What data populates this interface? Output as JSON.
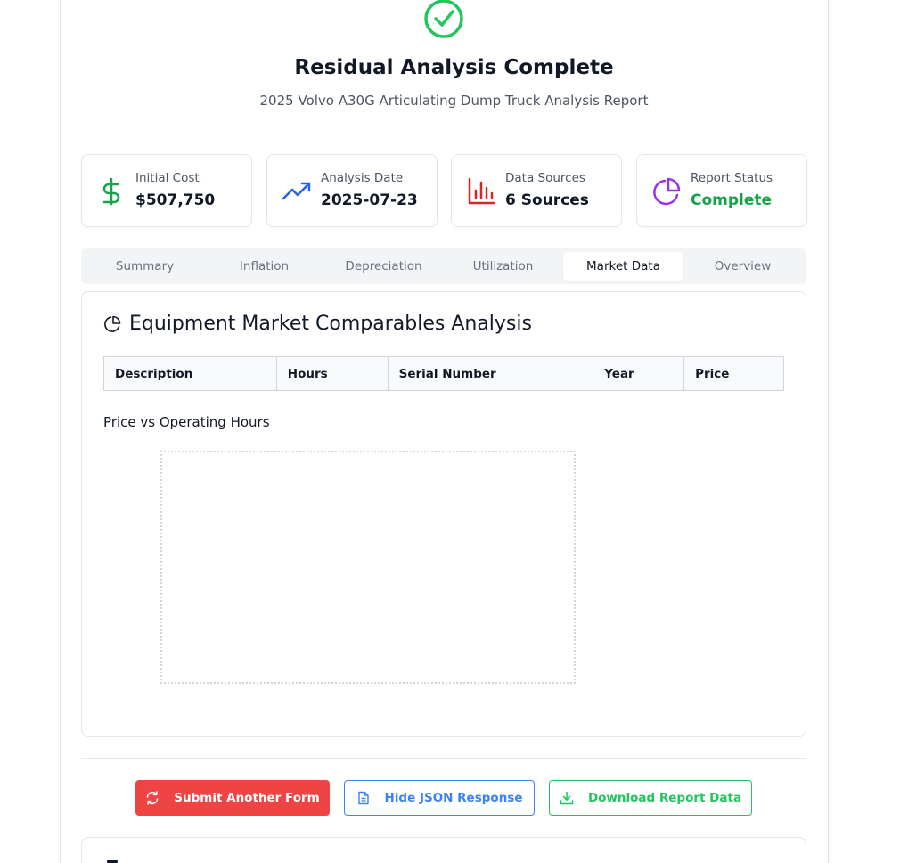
{
  "header": {
    "title": "Residual Analysis Complete",
    "subtitle": "2025 Volvo A30G Articulating Dump Truck Analysis Report"
  },
  "stats": [
    {
      "label": "Initial Cost",
      "value": "$507,750",
      "icon": "dollar-icon",
      "color": "#16a34a"
    },
    {
      "label": "Analysis Date",
      "value": "2025-07-23",
      "icon": "trending-up-icon",
      "color": "#2563eb"
    },
    {
      "label": "Data Sources",
      "value": "6 Sources",
      "icon": "bar-chart-icon",
      "color": "#dc2626"
    },
    {
      "label": "Report Status",
      "value": "Complete",
      "icon": "pie-chart-icon",
      "color": "#9333ea",
      "value_color": "#16a34a"
    }
  ],
  "tabs": [
    {
      "label": "Summary"
    },
    {
      "label": "Inflation"
    },
    {
      "label": "Depreciation"
    },
    {
      "label": "Utilization"
    },
    {
      "label": "Market Data",
      "active": true
    },
    {
      "label": "Overview"
    }
  ],
  "panel": {
    "title": "Equipment Market Comparables Analysis",
    "table_headers": [
      "Description",
      "Hours",
      "Serial Number",
      "Year",
      "Price"
    ],
    "chart_title": "Price vs Operating Hours"
  },
  "actions": {
    "submit_label": "Submit Another Form",
    "json_label": "Hide JSON Response",
    "download_label": "Download Report Data"
  },
  "colors": {
    "success": "#22c55e",
    "danger": "#ef4444",
    "primary": "#3b82f6"
  }
}
